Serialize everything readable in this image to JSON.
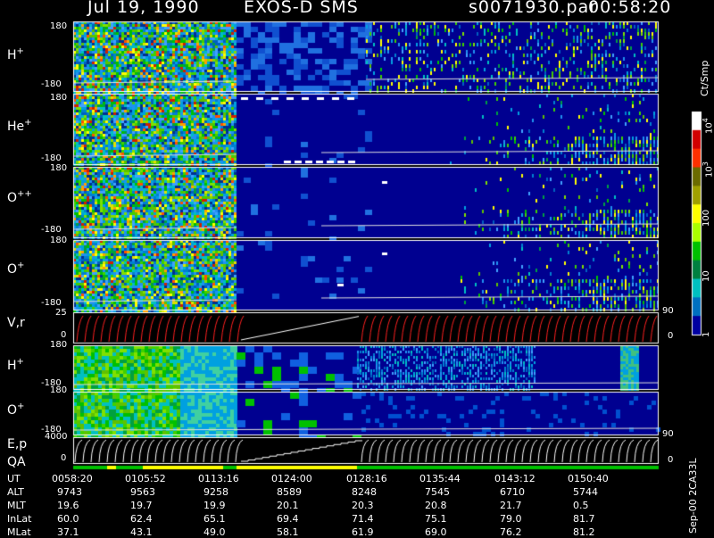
{
  "header": {
    "date": "Jul 19, 1990",
    "instrument": "EXOS-D SMS",
    "file": "s0071930.par",
    "time": "00:58:20"
  },
  "panels": [
    {
      "label": "H",
      "charge": "+",
      "ticks": [
        "180",
        "-180"
      ]
    },
    {
      "label": "He",
      "charge": "+",
      "ticks": [
        "180",
        "-180"
      ]
    },
    {
      "label": "O",
      "charge": "++",
      "ticks": [
        "180",
        "-180"
      ]
    },
    {
      "label": "O",
      "charge": "+",
      "ticks": [
        "180",
        "-180"
      ]
    },
    {
      "label": "V,r",
      "charge": "",
      "ticks": [
        "25",
        "0"
      ],
      "right_ticks": [
        "90",
        "0"
      ]
    },
    {
      "label": "H",
      "charge": "+",
      "ticks": [
        "180",
        "-180"
      ]
    },
    {
      "label": "O",
      "charge": "+",
      "ticks": [
        "180",
        "-180"
      ]
    },
    {
      "label": "E,p",
      "sublabel": "QA",
      "charge": "",
      "ticks": [
        "4000",
        "0"
      ],
      "right_ticks": [
        "90",
        "0"
      ]
    }
  ],
  "colorbar": {
    "unit": "Ct/Smp",
    "labels": [
      "10",
      "4",
      "10",
      "3",
      "100",
      "10",
      "1"
    ]
  },
  "footer": {
    "side_label": "Sep-00 2CA33L",
    "row_labels": [
      "UT",
      "ALT",
      "MLT",
      "InLat",
      "MLat"
    ],
    "columns": [
      {
        "UT": "0058:20",
        "ALT": "9743",
        "MLT": "19.6",
        "InLat": "60.0",
        "MLat": "37.1"
      },
      {
        "UT": "0105:52",
        "ALT": "9563",
        "MLT": "19.7",
        "InLat": "62.4",
        "MLat": "43.1"
      },
      {
        "UT": "0113:16",
        "ALT": "9258",
        "MLT": "19.9",
        "InLat": "65.1",
        "MLat": "49.0"
      },
      {
        "UT": "0124:00",
        "ALT": "8589",
        "MLT": "20.1",
        "InLat": "69.4",
        "MLat": "58.1"
      },
      {
        "UT": "0128:16",
        "ALT": "8248",
        "MLT": "20.3",
        "InLat": "71.4",
        "MLat": "61.9"
      },
      {
        "UT": "0135:44",
        "ALT": "7545",
        "MLT": "20.8",
        "InLat": "75.1",
        "MLat": "69.0"
      },
      {
        "UT": "0143:12",
        "ALT": "6710",
        "MLT": "21.7",
        "InLat": "79.0",
        "MLat": "76.2"
      },
      {
        "UT": "0150:40",
        "ALT": "5744",
        "MLT": "0.5",
        "InLat": "81.7",
        "MLat": "81.2"
      }
    ]
  },
  "chart_data": {
    "type": "heatmap",
    "x_axis_values": [
      "0058:20",
      "0105:52",
      "0113:16",
      "0124:00",
      "0128:16",
      "0135:44",
      "0143:12",
      "0150:40"
    ],
    "panels": [
      "H+",
      "He+",
      "O++",
      "O+",
      "V,r",
      "H+",
      "O+",
      "E,p / QA"
    ],
    "pitch_angle_range": [
      -180,
      180
    ],
    "vr_range": [
      0,
      25
    ],
    "ep_range": [
      0,
      4000
    ],
    "right_axis_range": [
      0,
      90
    ],
    "colorbar_ticks": [
      "10^4",
      "10^3",
      "100",
      "10",
      "1"
    ],
    "colorbar_colors": [
      "#ffffff",
      "#d00000",
      "#ff3000",
      "#6b6b00",
      "#a0a000",
      "#ffff00",
      "#aaff00",
      "#00c000",
      "#008040",
      "#00c0c0",
      "#0070c0",
      "#0000a0"
    ],
    "background_color": "#000090"
  }
}
